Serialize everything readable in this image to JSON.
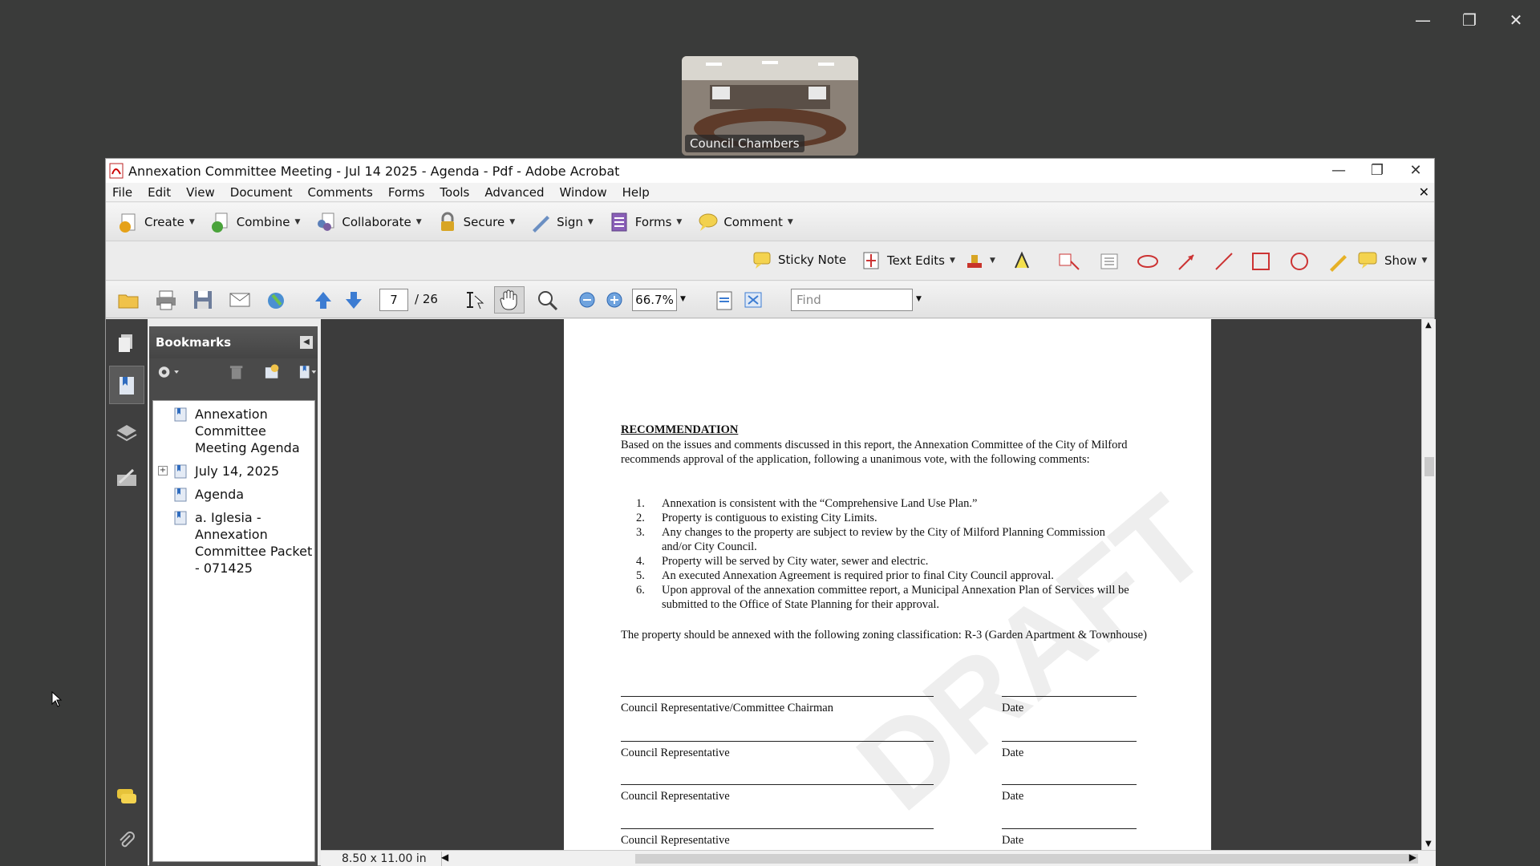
{
  "outer_window": {
    "minimize": "—",
    "maximize": "❐",
    "close": "✕"
  },
  "video": {
    "label": "Council Chambers"
  },
  "acrobat": {
    "title": "Annexation Committee Meeting - Jul 14 2025 - Agenda - Pdf - Adobe Acrobat",
    "menus": [
      "File",
      "Edit",
      "View",
      "Document",
      "Comments",
      "Forms",
      "Tools",
      "Advanced",
      "Window",
      "Help"
    ],
    "task_buttons": [
      "Create",
      "Combine",
      "Collaborate",
      "Secure",
      "Sign",
      "Forms",
      "Comment"
    ],
    "comment_tools": {
      "sticky_note": "Sticky Note",
      "text_edits": "Text Edits",
      "show": "Show"
    },
    "navigation": {
      "current_page": "7",
      "total_pages": "/ 26",
      "zoom": "66.7%",
      "find_placeholder": "Find"
    },
    "bookmarks_panel": {
      "title": "Bookmarks",
      "items": [
        {
          "label": "Annexation Committee Meeting Agenda"
        },
        {
          "label": "July 14, 2025",
          "expandable": true
        },
        {
          "label": "Agenda"
        },
        {
          "label": "a. Iglesia - Annexation Committee Packet - 071425"
        }
      ]
    },
    "page_size": "8.50 x 11.00 in"
  },
  "document": {
    "heading": "RECOMMENDATION",
    "paragraph": "Based on the issues and comments discussed in this report, the Annexation Committee of the City of Milford recommends approval of the application, following a unanimous vote, with the following comments:",
    "items": [
      {
        "num": "1.",
        "text": "Annexation is consistent with the “Comprehensive Land Use Plan.”"
      },
      {
        "num": "2.",
        "text": "Property is contiguous to existing City Limits."
      },
      {
        "num": "3.",
        "text": "Any changes to the property are subject to review by the City of Milford Planning Commission and/or City Council."
      },
      {
        "num": "4.",
        "text": "Property will be served by City water, sewer and electric."
      },
      {
        "num": "5.",
        "text": "An executed Annexation Agreement is required prior to final City Council approval."
      },
      {
        "num": "6.",
        "text": "Upon approval of the annexation committee report, a Municipal Annexation Plan of Services will be submitted to the Office of State Planning for their approval."
      }
    ],
    "zoning": "The property should be annexed with the following zoning classification: R-3 (Garden Apartment & Townhouse)",
    "signatures": [
      {
        "left": "Council Representative/Committee Chairman",
        "right": "Date"
      },
      {
        "left": "Council Representative",
        "right": "Date"
      },
      {
        "left": "Council Representative",
        "right": "Date"
      },
      {
        "left": "Council Representative",
        "right": "Date"
      }
    ],
    "watermark": "DRAFT"
  }
}
